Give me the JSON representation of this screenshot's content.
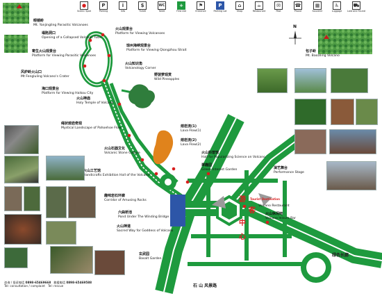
{
  "legend": [
    {
      "symbol": "●",
      "label": "Scenic Spot"
    },
    {
      "symbol": "P",
      "label": "Parking"
    },
    {
      "symbol": "i",
      "label": "Info"
    },
    {
      "symbol": "$",
      "label": "Ticket"
    },
    {
      "symbol": "WC",
      "label": "Toilet"
    },
    {
      "symbol": "+",
      "label": "First Aid"
    },
    {
      "symbol": "⚑",
      "label": "Entrance"
    },
    {
      "symbol": "P",
      "label": "Parking Lot"
    },
    {
      "symbol": "⌂",
      "label": "Shop"
    },
    {
      "symbol": "☕",
      "label": "Restaurant"
    },
    {
      "symbol": "✉",
      "label": "Post"
    },
    {
      "symbol": "☎",
      "label": "Phone"
    },
    {
      "symbol": "▦",
      "label": "Souvenir"
    },
    {
      "symbol": "♿",
      "label": "Luggage"
    },
    {
      "symbol": "⛟",
      "label": "Lost and Found"
    }
  ],
  "places": {
    "yanjingling": {
      "zh": "眼镜岭",
      "en": "Mt. Yanjingling Parasitic Volcanoes"
    },
    "baozi": {
      "zh": "包子岭",
      "en": "Mt. Baoziling Volcano"
    },
    "tube": {
      "zh": "塌陷洞口",
      "en": "Opening of a Collapsed Volcanic Tube"
    },
    "parasitic_platform": {
      "zh": "寄生火山观景台",
      "en": "Platform for Viewing Parasitic Volcanoes"
    },
    "viewing_volcanoes": {
      "zh": "火山观景台",
      "en": "Platform for Viewing Volcanoes"
    },
    "fengluling": {
      "zh": "风炉岭火山口",
      "en": "Mt Fengluling Volcano's Crater"
    },
    "qiongzhou": {
      "zh": "琼州海峡观景台",
      "en": "Platform for Viewing Qiongzhou Strait"
    },
    "haikou": {
      "zh": "海口观景台",
      "en": "Platform for Viewing Haikou City"
    },
    "knowledge": {
      "zh": "火山知识角",
      "en": "Volcanology Corner"
    },
    "pineapples": {
      "zh": "野菠萝观赏",
      "en": "Wild Pineapples"
    },
    "temple": {
      "zh": "火山神庙",
      "en": "Holy Temple of Volcano"
    },
    "pahoehoe": {
      "zh": "绳状熔岩奇观",
      "en": "Mystical Landscape of Pahoehoe Flow"
    },
    "lava1": {
      "zh": "熔岩流(1)",
      "en": "Lava Flow(1)"
    },
    "lava2": {
      "zh": "熔岩流(2)",
      "en": "Lava Flow(2)"
    },
    "stone": {
      "zh": "火山石器文化",
      "en": "Volcanic Stone Culture"
    },
    "science": {
      "zh": "火山科普馆",
      "en": "Hall for Popularizing Science on Volcano"
    },
    "garden": {
      "zh": "翠趣园",
      "en": "Green Interest Garden"
    },
    "handicraft": {
      "zh": "火山工艺馆",
      "en": "Handicrafts Exhibition Hall of the Volcano"
    },
    "stage": {
      "zh": "演艺舞台",
      "en": "Performance Stage"
    },
    "corridor": {
      "zh": "趣味岩石环廊",
      "en": "Corridor of Amusing Rocks"
    },
    "restaurant": {
      "zh": "",
      "en": "Volcano Restaurant"
    },
    "pond": {
      "zh": "六曲桥池",
      "en": "Pond Under The Winding Bridge"
    },
    "bar": {
      "zh": "火山休闲吧",
      "en": "Volcano leisure Bar"
    },
    "sacred": {
      "zh": "火山神道",
      "en": "Sacred Way for Goddess of Volcano"
    },
    "basalt": {
      "zh": "玄武园",
      "en": "Basalt Garden"
    },
    "center_chars": [
      "游",
      "客",
      "中",
      "心"
    ],
    "tourist_dest": "Tourist Destination"
  },
  "roads": {
    "green_corridor": "绿色长廊",
    "stone_wind": "石 山 风景路"
  },
  "compass": "N",
  "footer": {
    "complaint_zh": "咨询 / 投诉电话",
    "complaint_no": "0898-65469668",
    "rescue_zh": "救援电话",
    "rescue_no": "0898-65469588",
    "complaint_en": "Tel: consultation / complaint",
    "rescue_en": "Tel: rescue"
  },
  "photo_captions": [
    "",
    "",
    "",
    "",
    "",
    "",
    "",
    "",
    ""
  ],
  "colors": {
    "road_green": "#1e9a3e",
    "road_white": "#ffffff",
    "accent_red": "#d81e1e",
    "lava": "#e0831c",
    "water": "#2d56a8",
    "forest": "#2f7d3c"
  }
}
